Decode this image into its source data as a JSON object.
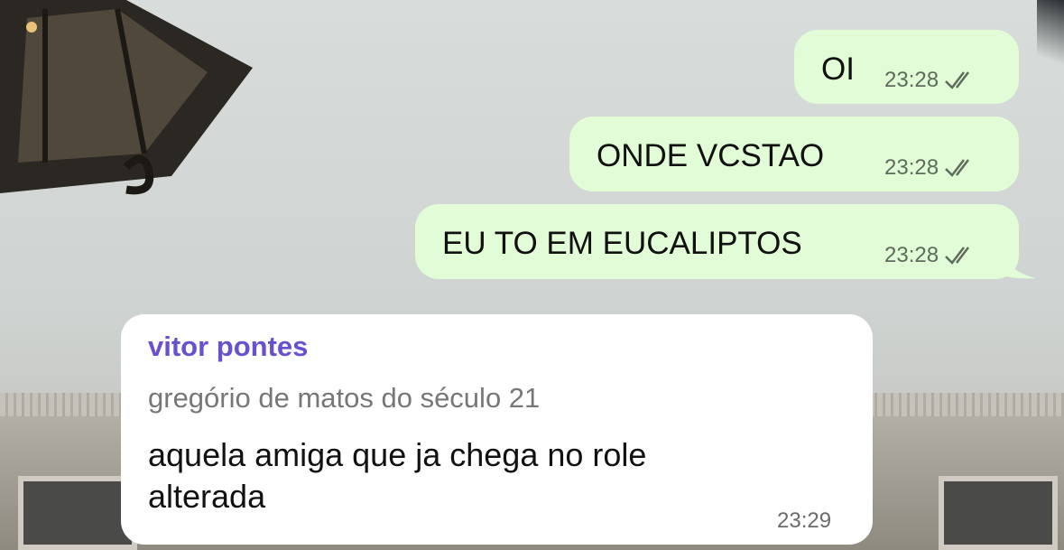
{
  "chat": {
    "messages": [
      {
        "direction": "outgoing",
        "text": "OI",
        "time": "23:28",
        "status": "read-double-check-icon"
      },
      {
        "direction": "outgoing",
        "text": "ONDE VCSTAO",
        "time": "23:28",
        "status": "read-double-check-icon"
      },
      {
        "direction": "outgoing",
        "text": "EU TO EM EUCALIPTOS",
        "time": "23:28",
        "status": "read-double-check-icon"
      },
      {
        "direction": "incoming",
        "sender": "vitor pontes",
        "subtitle": "gregório de matos do século 21",
        "text_line1": "aquela amiga que ja chega no role",
        "text_line2": "alterada",
        "time": "23:29"
      }
    ]
  },
  "colors": {
    "outgoing_bubble": "#e1fcd6",
    "incoming_bubble": "#ffffff",
    "sender_name": "#6b4fd1"
  }
}
